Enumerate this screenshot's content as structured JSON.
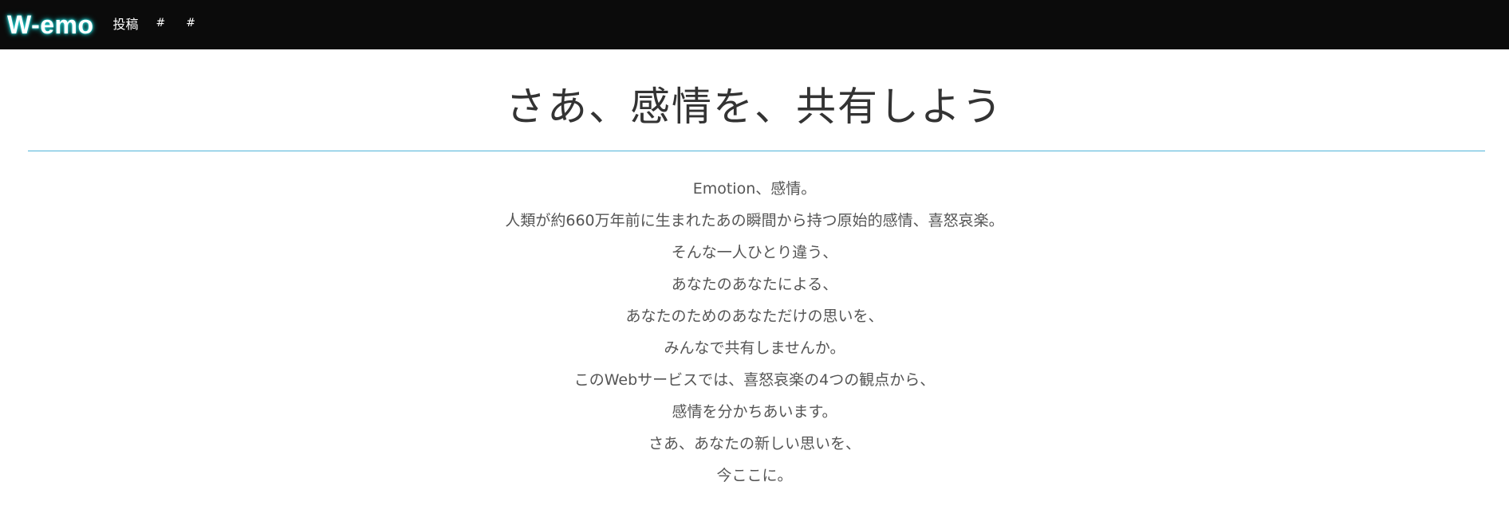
{
  "navbar": {
    "brand": "W-emo",
    "links": [
      {
        "label": "投稿"
      },
      {
        "label": "#"
      },
      {
        "label": "#"
      }
    ]
  },
  "hero": {
    "title": "さあ、感情を、共有しよう"
  },
  "intro": {
    "lines": [
      "Emotion、感情。",
      "人類が約660万年前に生まれたあの瞬間から持つ原始的感情、喜怒哀楽。",
      "そんな一人ひとり違う、",
      "あなたのあなたによる、",
      "あなたのためのあなただけの思いを、",
      "みんなで共有しませんか。",
      "このWebサービスでは、喜怒哀楽の4つの観点から、",
      "感情を分かちあいます。",
      "さあ、あなたの新しい思いを、",
      "今ここに。"
    ]
  }
}
